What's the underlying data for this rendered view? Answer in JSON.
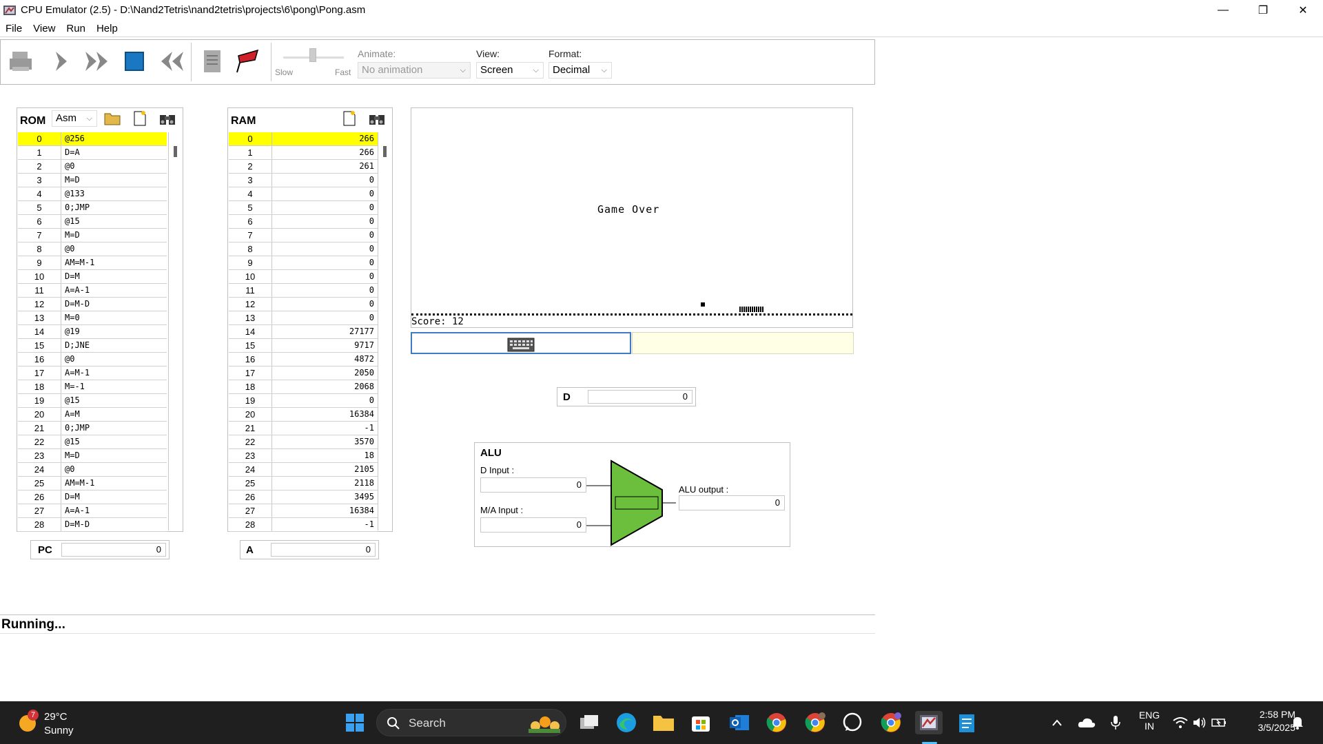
{
  "window": {
    "title": "CPU Emulator (2.5) - D:\\Nand2Tetris\\nand2tetris\\projects\\6\\pong\\Pong.asm",
    "minimize": "—",
    "maximize": "❐",
    "close": "✕"
  },
  "menu": [
    "File",
    "View",
    "Run",
    "Help"
  ],
  "toolbar": {
    "slow_label": "Slow",
    "fast_label": "Fast",
    "animate_label": "Animate:",
    "animate_value": "No animation",
    "view_label": "View:",
    "view_value": "Screen",
    "format_label": "Format:",
    "format_value": "Decimal"
  },
  "rom": {
    "title": "ROM",
    "format": "Asm",
    "rows": [
      [
        "0",
        "@256"
      ],
      [
        "1",
        "D=A"
      ],
      [
        "2",
        "@0"
      ],
      [
        "3",
        "M=D"
      ],
      [
        "4",
        "@133"
      ],
      [
        "5",
        "0;JMP"
      ],
      [
        "6",
        "@15"
      ],
      [
        "7",
        "M=D"
      ],
      [
        "8",
        "@0"
      ],
      [
        "9",
        "AM=M-1"
      ],
      [
        "10",
        "D=M"
      ],
      [
        "11",
        "A=A-1"
      ],
      [
        "12",
        "D=M-D"
      ],
      [
        "13",
        "M=0"
      ],
      [
        "14",
        "@19"
      ],
      [
        "15",
        "D;JNE"
      ],
      [
        "16",
        "@0"
      ],
      [
        "17",
        "A=M-1"
      ],
      [
        "18",
        "M=-1"
      ],
      [
        "19",
        "@15"
      ],
      [
        "20",
        "A=M"
      ],
      [
        "21",
        "0;JMP"
      ],
      [
        "22",
        "@15"
      ],
      [
        "23",
        "M=D"
      ],
      [
        "24",
        "@0"
      ],
      [
        "25",
        "AM=M-1"
      ],
      [
        "26",
        "D=M"
      ],
      [
        "27",
        "A=A-1"
      ],
      [
        "28",
        "D=M-D"
      ]
    ]
  },
  "ram": {
    "title": "RAM",
    "rows": [
      [
        "0",
        "266"
      ],
      [
        "1",
        "266"
      ],
      [
        "2",
        "261"
      ],
      [
        "3",
        "0"
      ],
      [
        "4",
        "0"
      ],
      [
        "5",
        "0"
      ],
      [
        "6",
        "0"
      ],
      [
        "7",
        "0"
      ],
      [
        "8",
        "0"
      ],
      [
        "9",
        "0"
      ],
      [
        "10",
        "0"
      ],
      [
        "11",
        "0"
      ],
      [
        "12",
        "0"
      ],
      [
        "13",
        "0"
      ],
      [
        "14",
        "27177"
      ],
      [
        "15",
        "9717"
      ],
      [
        "16",
        "4872"
      ],
      [
        "17",
        "2050"
      ],
      [
        "18",
        "2068"
      ],
      [
        "19",
        "0"
      ],
      [
        "20",
        "16384"
      ],
      [
        "21",
        "-1"
      ],
      [
        "22",
        "3570"
      ],
      [
        "23",
        "18"
      ],
      [
        "24",
        "2105"
      ],
      [
        "25",
        "2118"
      ],
      [
        "26",
        "3495"
      ],
      [
        "27",
        "16384"
      ],
      [
        "28",
        "-1"
      ]
    ]
  },
  "registers": {
    "pc_label": "PC",
    "pc_value": "0",
    "a_label": "A",
    "a_value": "0",
    "d_label": "D",
    "d_value": "0"
  },
  "screen": {
    "text": "Game Over",
    "score": "Score: 12"
  },
  "alu": {
    "title": "ALU",
    "d_input_label": "D Input :",
    "d_input_value": "0",
    "ma_input_label": "M/A Input :",
    "ma_input_value": "0",
    "output_label": "ALU output :",
    "output_value": "0"
  },
  "status": "Running...",
  "taskbar": {
    "weather_temp": "29°C",
    "weather_desc": "Sunny",
    "weather_badge": "7",
    "search_label": "Search",
    "lang_line1": "ENG",
    "lang_line2": "IN",
    "time": "2:58 PM",
    "date": "3/5/2025"
  }
}
